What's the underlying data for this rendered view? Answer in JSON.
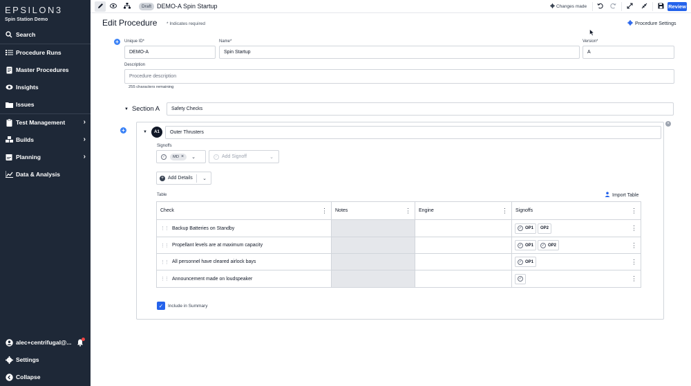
{
  "app": {
    "brand": "EPSILON3",
    "workspace": "Spin Station Demo"
  },
  "sidebar": {
    "items": [
      {
        "label": "Search"
      },
      {
        "label": "Procedure Runs"
      },
      {
        "label": "Master Procedures"
      },
      {
        "label": "Insights"
      },
      {
        "label": "Issues"
      },
      {
        "label": "Test Management"
      },
      {
        "label": "Builds"
      },
      {
        "label": "Planning"
      },
      {
        "label": "Data & Analysis"
      }
    ],
    "user": "alec+centrifugal@...",
    "settings": "Settings",
    "collapse": "Collapse"
  },
  "toolbar": {
    "status_badge": "Draft",
    "title": "DEMO-A Spin Startup",
    "changes": "Changes made",
    "review": "Review"
  },
  "page": {
    "title": "Edit Procedure",
    "note": "* Indicates required",
    "settings_link": "Procedure Settings"
  },
  "form": {
    "uid_label": "Unique ID*",
    "uid_value": "DEMO-A",
    "name_label": "Name*",
    "name_value": "Spin Startup",
    "version_label": "Version*",
    "version_value": "A",
    "desc_label": "Description",
    "desc_placeholder": "Procedure description",
    "chars_remaining": "255 characters remaining"
  },
  "section": {
    "label": "Section A",
    "name": "Safety Checks",
    "step": {
      "badge": "A1",
      "name": "Outer Thrusters",
      "signoffs_label": "Signoffs",
      "signoff_chip": "MD",
      "add_signoff": "Add Signoff",
      "add_details": "Add Details",
      "table_label": "Table",
      "import_table": "Import Table",
      "columns": [
        "Check",
        "Notes",
        "Engine",
        "Signoffs"
      ],
      "rows": [
        {
          "check": "Backup Batteries on Standby",
          "signoffs": [
            "OP1",
            "OP2"
          ]
        },
        {
          "check": "Propellant levels are at maximum capacity",
          "signoffs": [
            "OP1",
            "OP2"
          ]
        },
        {
          "check": "All personnel have cleared airlock bays",
          "signoffs": [
            "OP1"
          ]
        },
        {
          "check": "Announcement made on loudspeaker",
          "signoffs": []
        }
      ],
      "include_summary": "Include in Summary"
    }
  },
  "colors": {
    "sidebar_bg": "#1e2837",
    "accent": "#2563eb",
    "notification": "#ef4444"
  }
}
